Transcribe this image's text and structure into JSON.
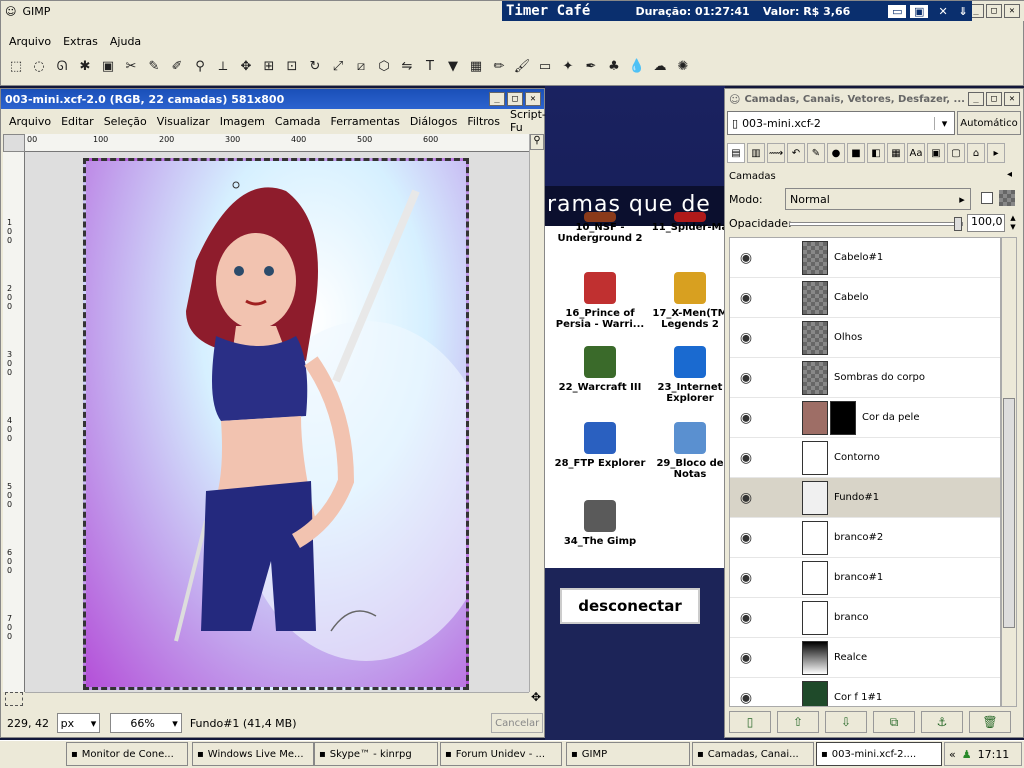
{
  "main_window": {
    "title": "GIMP",
    "menu": [
      "Arquivo",
      "Extras",
      "Ajuda"
    ],
    "tools": [
      "rect-select",
      "ellipse-select",
      "lasso",
      "fuzzy-select",
      "color-select",
      "scissors",
      "paths",
      "color-picker",
      "zoom",
      "measure",
      "move",
      "align",
      "crop",
      "rotate",
      "scale",
      "shear",
      "perspective",
      "flip",
      "text",
      "bucket-fill",
      "blend",
      "pencil",
      "paintbrush",
      "eraser",
      "airbrush",
      "ink",
      "clone",
      "blur",
      "smudge",
      "dodge"
    ]
  },
  "timer": {
    "title": "Timer Café",
    "duration_label": "Duração: 01:27:41",
    "value_label": "Valor: R$ 3,66"
  },
  "image_window": {
    "title": "003-mini.xcf-2.0 (RGB, 22 camadas) 581x800",
    "menu": [
      "Arquivo",
      "Editar",
      "Seleção",
      "Visualizar",
      "Imagem",
      "Camada",
      "Ferramentas",
      "Diálogos",
      "Filtros",
      "Script-Fu"
    ],
    "ruler_labels": [
      "00",
      "100",
      "200",
      "300",
      "400",
      "500",
      "600"
    ],
    "vruler_labels": [
      "100",
      "200",
      "300",
      "400",
      "500",
      "600",
      "700"
    ],
    "coords": "229, 42",
    "unit": "px",
    "zoom": "66%",
    "status": "Fundo#1 (41,4 MB)",
    "cancel": "Cancelar"
  },
  "desktop": {
    "banner_text": "ramas que de",
    "icons": [
      {
        "label": "10_NSF - Underground 2"
      },
      {
        "label": "11_Spider-Ma"
      },
      {
        "label": "16_Prince of Persia - Warri..."
      },
      {
        "label": "17_X-Men(TM Legends 2"
      },
      {
        "label": "22_Warcraft III"
      },
      {
        "label": "23_Internet Explorer"
      },
      {
        "label": "28_FTP Explorer"
      },
      {
        "label": "29_Bloco de Notas"
      },
      {
        "label": "34_The Gimp"
      }
    ],
    "disconnect_label": "desconectar"
  },
  "layers_window": {
    "title": "Camadas, Canais, Vetores, Desfazer, ...",
    "image_select": "003-mini.xcf-2",
    "auto_button": "Automático",
    "panel_title": "Camadas",
    "mode_label": "Modo:",
    "mode_value": "Normal",
    "opacity_label": "Opacidade:",
    "opacity_value": "100,0",
    "layers": [
      {
        "name": "Cabelo#1",
        "thumb": "checker"
      },
      {
        "name": "Cabelo",
        "thumb": "checker"
      },
      {
        "name": "Olhos",
        "thumb": "checker"
      },
      {
        "name": "Sombras do corpo",
        "thumb": "checker"
      },
      {
        "name": "Cor da pele",
        "thumb": "#9e6e66"
      },
      {
        "name": "Contorno",
        "thumb": "#ffffff"
      },
      {
        "name": "Fundo#1",
        "thumb": "#f0f0f0"
      },
      {
        "name": "branco#2",
        "thumb": "#ffffff"
      },
      {
        "name": "branco#1",
        "thumb": "#ffffff"
      },
      {
        "name": "branco",
        "thumb": "#ffffff"
      },
      {
        "name": "Realce",
        "thumb": "gradient"
      },
      {
        "name": "Cor f 1#1",
        "thumb": "#1f4a2a"
      }
    ],
    "selected_layer": "Fundo#1"
  },
  "taskbar": {
    "items": [
      "Monitor de Cone...",
      "Windows Live Me...",
      "Skype™ - kinrpg",
      "Forum Unidev - ...",
      "GIMP",
      "Camadas, Canai...",
      "003-mini.xcf-2...."
    ],
    "active": "003-mini.xcf-2....",
    "tray_chevron": "«",
    "clock": "17:11"
  }
}
